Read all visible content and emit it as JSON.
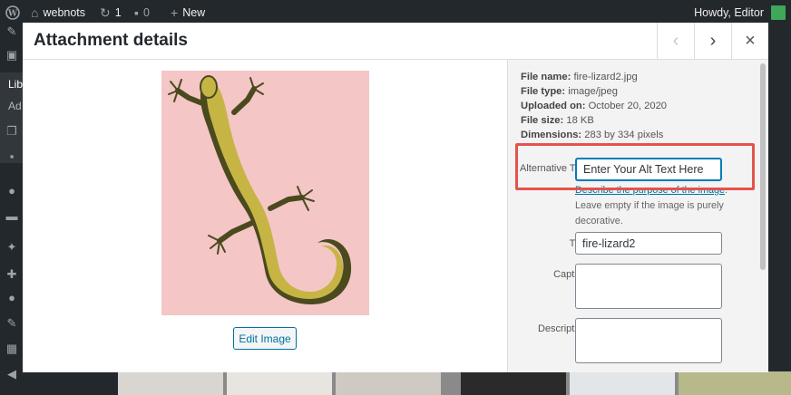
{
  "admin_bar": {
    "site_name": "webnots",
    "updates_count": "1",
    "comments_count": "0",
    "new_label": "New",
    "howdy": "Howdy, Editor"
  },
  "admin_menu": {
    "partial_labels": [
      "Lib",
      "Ad"
    ]
  },
  "modal": {
    "title": "Attachment details",
    "prev_icon": "‹",
    "next_icon": "›",
    "close_icon": "×",
    "edit_image_label": "Edit Image",
    "image_alt": "fire-lizard2"
  },
  "file_info": {
    "file_name_label": "File name:",
    "file_name": "fire-lizard2.jpg",
    "file_type_label": "File type:",
    "file_type": "image/jpeg",
    "uploaded_label": "Uploaded on:",
    "uploaded": "October 20, 2020",
    "size_label": "File size:",
    "size": "18 KB",
    "dimensions_label": "Dimensions:",
    "dimensions": "283 by 334 pixels"
  },
  "fields": {
    "alt_label": "Alternative Text",
    "alt_value": "Enter Your Alt Text Here",
    "alt_help_link": "Describe the purpose of the image",
    "alt_help_rest": ". Leave empty if the image is purely decorative.",
    "title_label": "Title",
    "title_value": "fire-lizard2",
    "caption_label": "Caption",
    "caption_value": "",
    "description_label": "Description",
    "description_value": ""
  },
  "colors": {
    "highlight": "#e5534b",
    "accent": "#0071a1",
    "image_bg": "#f4c6c6"
  }
}
